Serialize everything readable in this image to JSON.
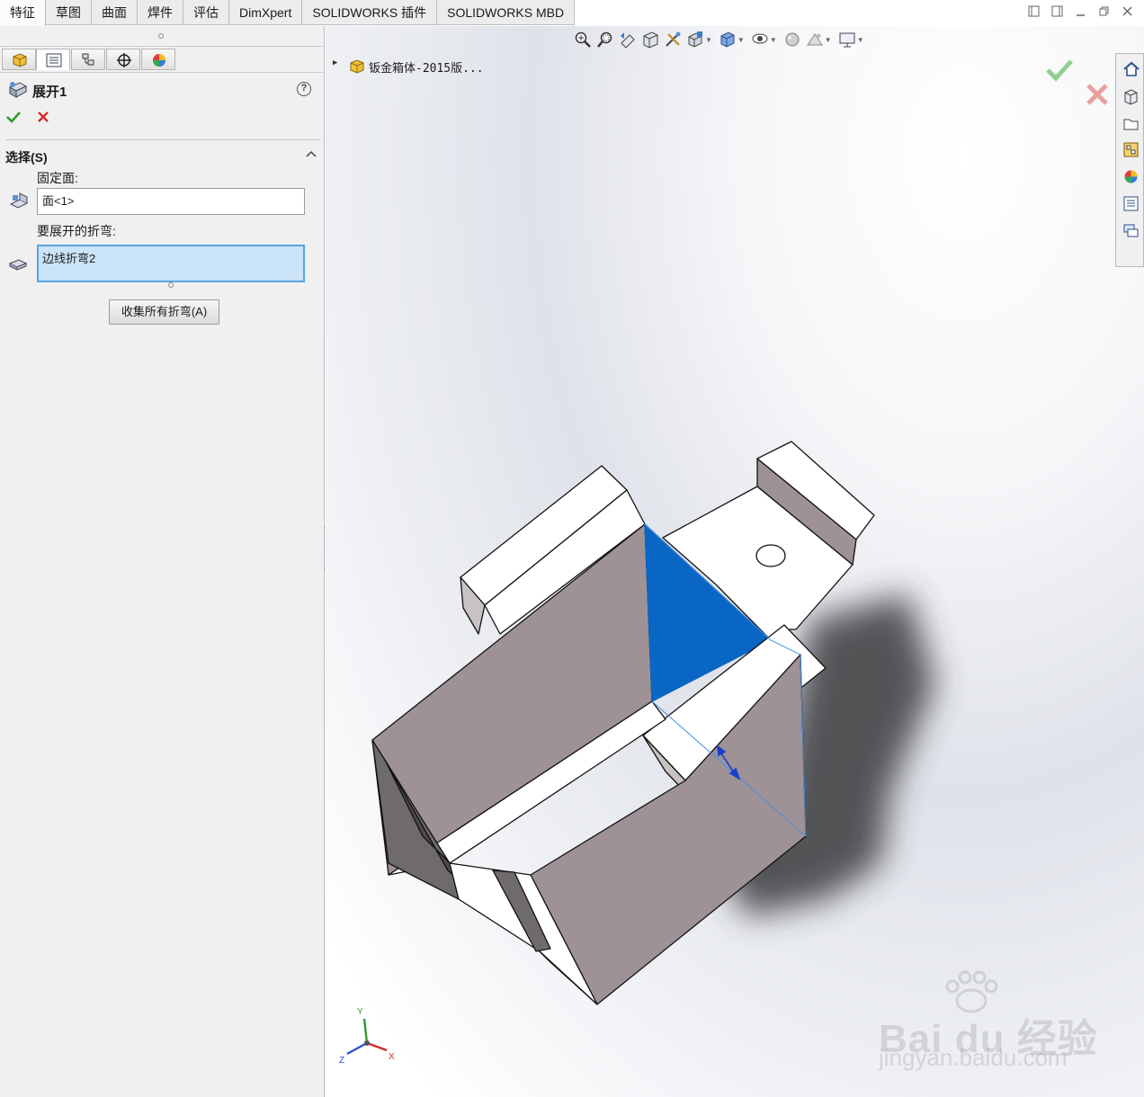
{
  "tabs": [
    {
      "label": "特征",
      "active": true
    },
    {
      "label": "草图",
      "active": false
    },
    {
      "label": "曲面",
      "active": false
    },
    {
      "label": "焊件",
      "active": false
    },
    {
      "label": "评估",
      "active": false
    },
    {
      "label": "DimXpert",
      "active": false
    },
    {
      "label": "SOLIDWORKS 插件",
      "active": false
    },
    {
      "label": "SOLIDWORKS MBD",
      "active": false
    }
  ],
  "window_controls": [
    "restore-left-icon",
    "restore-right-icon",
    "minimize-icon",
    "maximize-icon",
    "close-icon"
  ],
  "property_manager": {
    "tabs": [
      "feature-manager-icon",
      "property-manager-icon",
      "configuration-manager-icon",
      "dimxpert-manager-icon",
      "display-manager-icon"
    ],
    "title": "展开1",
    "section": {
      "title": "选择(S)",
      "fixed_face_label": "固定面:",
      "fixed_face_value": "面<1>",
      "bends_label": "要展开的折弯:",
      "bends_items": [
        "边线折弯2"
      ],
      "collect_button": "收集所有折弯(A)"
    }
  },
  "viewport": {
    "tree_node": "钣金箱体-2015版...",
    "heads_up_icons": [
      "zoom-to-fit-icon",
      "zoom-area-icon",
      "previous-view-icon",
      "section-view-icon",
      "dynamic-annotation-icon",
      "view-orientation-icon",
      "display-style-icon",
      "hide-show-items-icon",
      "edit-appearance-icon",
      "apply-scene-icon",
      "view-settings-icon"
    ],
    "task_pane": [
      "home-icon",
      "design-library-icon",
      "file-explorer-icon",
      "view-palette-icon",
      "appearances-icon",
      "custom-properties-icon",
      "forum-icon"
    ],
    "triad": {
      "x": "X",
      "y": "Y",
      "z": "Z"
    },
    "watermark": {
      "logo": "Bai du 经验",
      "url": "jingyan.baidu.com"
    }
  },
  "colors": {
    "selected_face": "#0a66c4",
    "part_body": "#9e9297",
    "part_edge": "#111111",
    "ok_green": "#2c9a2c",
    "cancel_red": "#d32424",
    "list_selection": "#cce4f7"
  }
}
